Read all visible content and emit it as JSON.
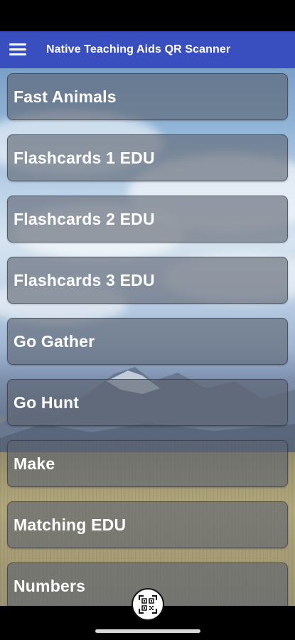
{
  "app_bar": {
    "title": "Native Teaching Aids QR Scanner",
    "background_color": "#3a4fbf",
    "menu_icon": "hamburger-menu-icon"
  },
  "menu": {
    "items": [
      {
        "label": "Fast Animals"
      },
      {
        "label": "Flashcards 1 EDU"
      },
      {
        "label": "Flashcards 2 EDU"
      },
      {
        "label": "Flashcards 3 EDU"
      },
      {
        "label": "Go Gather"
      },
      {
        "label": "Go Hunt"
      },
      {
        "label": "Make"
      },
      {
        "label": "Matching EDU"
      },
      {
        "label": "Numbers"
      }
    ]
  },
  "scan_button": {
    "icon": "qr-code-scan-icon"
  },
  "background": {
    "scene": "landscape-photo"
  }
}
